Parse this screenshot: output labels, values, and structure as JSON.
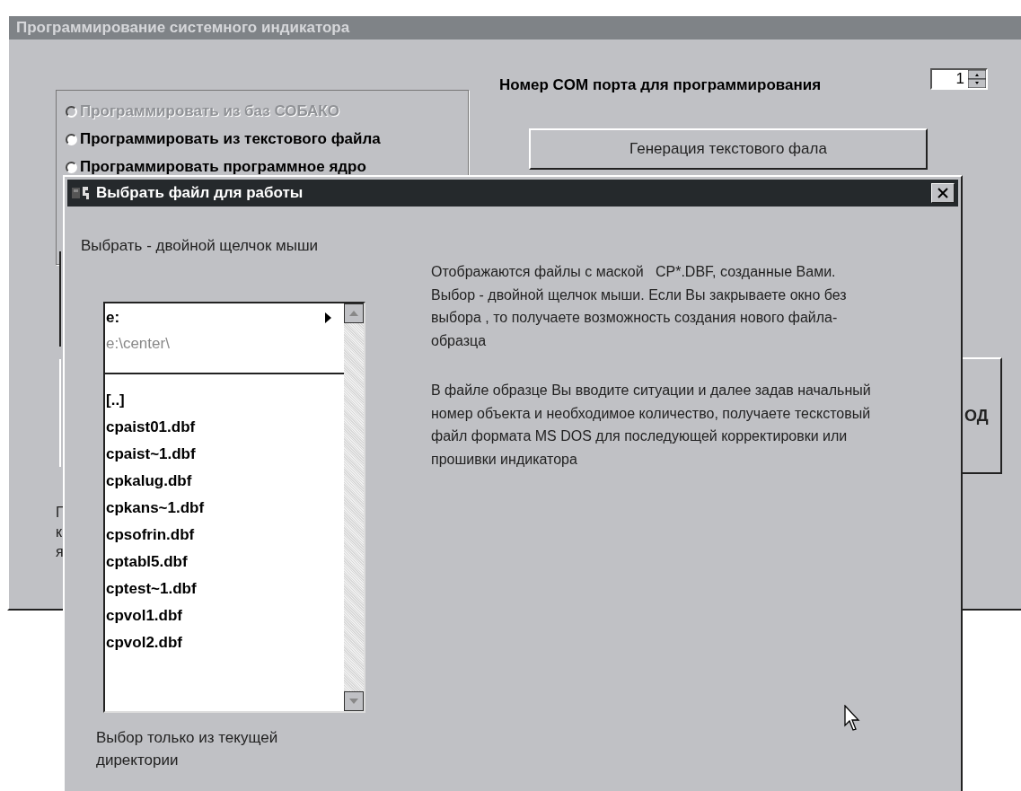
{
  "main_window": {
    "title": "Программирование системного индикатора",
    "com_port": {
      "label": "Номер COM порта для программирования",
      "value": "1"
    },
    "radio_options": [
      {
        "label": "Программировать из баз СОБАКО",
        "selected": false,
        "disabled": true
      },
      {
        "label": "Программировать из текстового файла",
        "selected": false,
        "disabled": false
      },
      {
        "label": "Программировать программное ядро",
        "selected": false,
        "disabled": false
      }
    ],
    "generate_button": "Генерация текстового фала",
    "covered_text": [
      "Г",
      "к",
      "я"
    ],
    "exit_button_fragment": "ОД"
  },
  "dialog": {
    "title": "Выбрать файл для работы",
    "hint": "Выбрать - двойной щелчок мыши",
    "drive": "e:",
    "path": "e:\\center\\",
    "files": [
      "[..]",
      "cpaist01.dbf",
      "cpaist~1.dbf",
      "cpkalug.dbf",
      "cpkans~1.dbf",
      "cpsofrin.dbf",
      "cptabl5.dbf",
      "cptest~1.dbf",
      "cpvol1.dbf",
      "cpvol2.dbf"
    ],
    "footer": "Выбор только из текущей директории",
    "description": [
      "Отображаются файлы с маской   CP*.DBF, созданные Вами. Выбор - двойной щелчок мыши. Если Вы закрываете окно без выбора , то получаете возможность создания нового файла-образца",
      "В файле образце Вы вводите ситуации и далее задав начальный номер объекта и необходимое количество, получаете тескстовый файл формата MS DOS для последующей корректировки или прошивки индикатора"
    ]
  }
}
